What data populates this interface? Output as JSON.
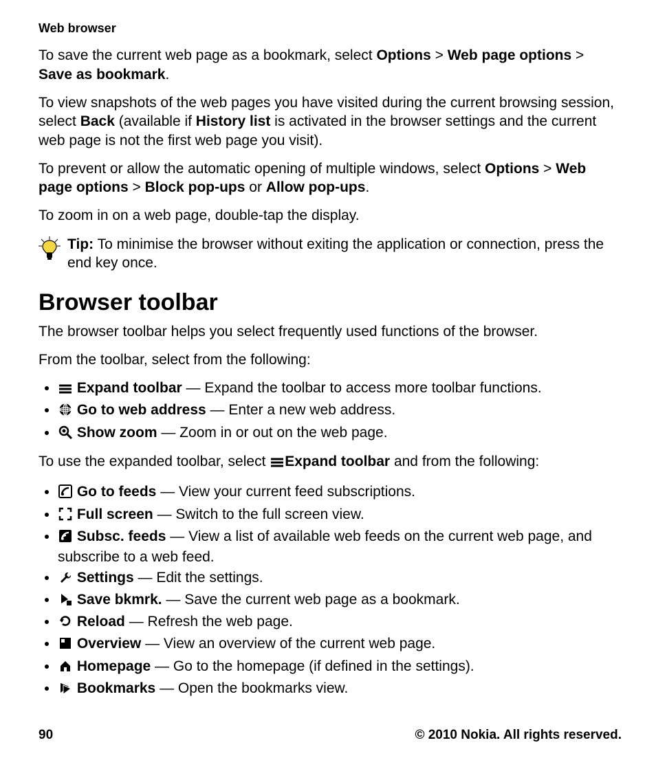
{
  "header": "Web browser",
  "p1": {
    "t1": "To save the current web page as a bookmark, select ",
    "b1": "Options",
    "s1": " > ",
    "b2": "Web page options",
    "s2": " > ",
    "b3": "Save as bookmark",
    "t2": "."
  },
  "p2": {
    "t1": "To view snapshots of the web pages you have visited during the current browsing session, select ",
    "b1": "Back",
    "t2": " (available if ",
    "b2": "History list",
    "t3": " is activated in the browser settings and the current web page is not the first web page you visit)."
  },
  "p3": {
    "t1": "To prevent or allow the automatic opening of multiple windows, select ",
    "b1": "Options",
    "s1": " > ",
    "b2": "Web page options",
    "s2": " > ",
    "b3": "Block pop-ups",
    "t2": " or ",
    "b4": "Allow pop-ups",
    "t3": "."
  },
  "p4": "To zoom in on a web page, double-tap the display.",
  "tip": {
    "label": "Tip:",
    "text": " To minimise the browser without exiting the application or connection, press the end key once."
  },
  "section_title": "Browser toolbar",
  "p5": "The browser toolbar helps you select frequently used functions of the browser.",
  "p6": "From the toolbar, select from the following:",
  "list1": [
    {
      "label": "Expand toolbar",
      "desc": " — Expand the toolbar to access more toolbar functions."
    },
    {
      "label": "Go to web address",
      "desc": " — Enter a new web address."
    },
    {
      "label": "Show zoom",
      "desc": " — Zoom in or out on the web page."
    }
  ],
  "p7": {
    "t1": "To use the expanded toolbar, select ",
    "b1": "Expand toolbar",
    "t2": " and from the following:"
  },
  "list2": [
    {
      "label": "Go to feeds",
      "desc": " — View your current feed subscriptions."
    },
    {
      "label": "Full screen",
      "desc": " — Switch to the full screen view."
    },
    {
      "label": "Subsc. feeds",
      "desc": " — View a list of available web feeds on the current web page, and subscribe to a web feed."
    },
    {
      "label": "Settings",
      "desc": " — Edit the settings."
    },
    {
      "label": "Save bkmrk.",
      "desc": " — Save the current web page as a bookmark."
    },
    {
      "label": "Reload",
      "desc": " — Refresh the web page."
    },
    {
      "label": "Overview",
      "desc": " — View an overview of the current web page."
    },
    {
      "label": "Homepage",
      "desc": " — Go to the homepage (if defined in the settings)."
    },
    {
      "label": "Bookmarks",
      "desc": " — Open the bookmarks view."
    }
  ],
  "footer": {
    "page": "90",
    "copyright": "© 2010 Nokia. All rights reserved."
  }
}
